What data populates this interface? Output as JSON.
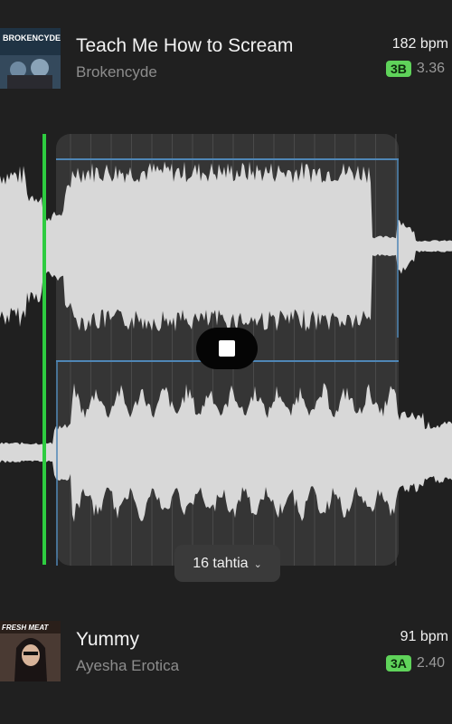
{
  "tracks": [
    {
      "title": "Teach Me How to Scream",
      "artist": "Brokencyde",
      "bpm": "182 bpm",
      "key": "3B",
      "duration": "3.36",
      "artwork_text": "BROKENCYDE",
      "artwork_colors": [
        "#1f3344",
        "#5d7a94"
      ]
    },
    {
      "title": "Yummy",
      "artist": "Ayesha Erotica",
      "bpm": "91 bpm",
      "key": "3A",
      "duration": "2.40",
      "artwork_text": "FRESH MEAT",
      "artwork_colors": [
        "#3a2a24",
        "#c9a58a"
      ]
    }
  ],
  "player": {
    "playhead_color": "#2ecc40",
    "waveform_color": "#d8d8d8",
    "loop_bars_label": "16 tahtia",
    "stop_icon": "stop-icon",
    "chevron_icon": "chevron-down-icon"
  }
}
